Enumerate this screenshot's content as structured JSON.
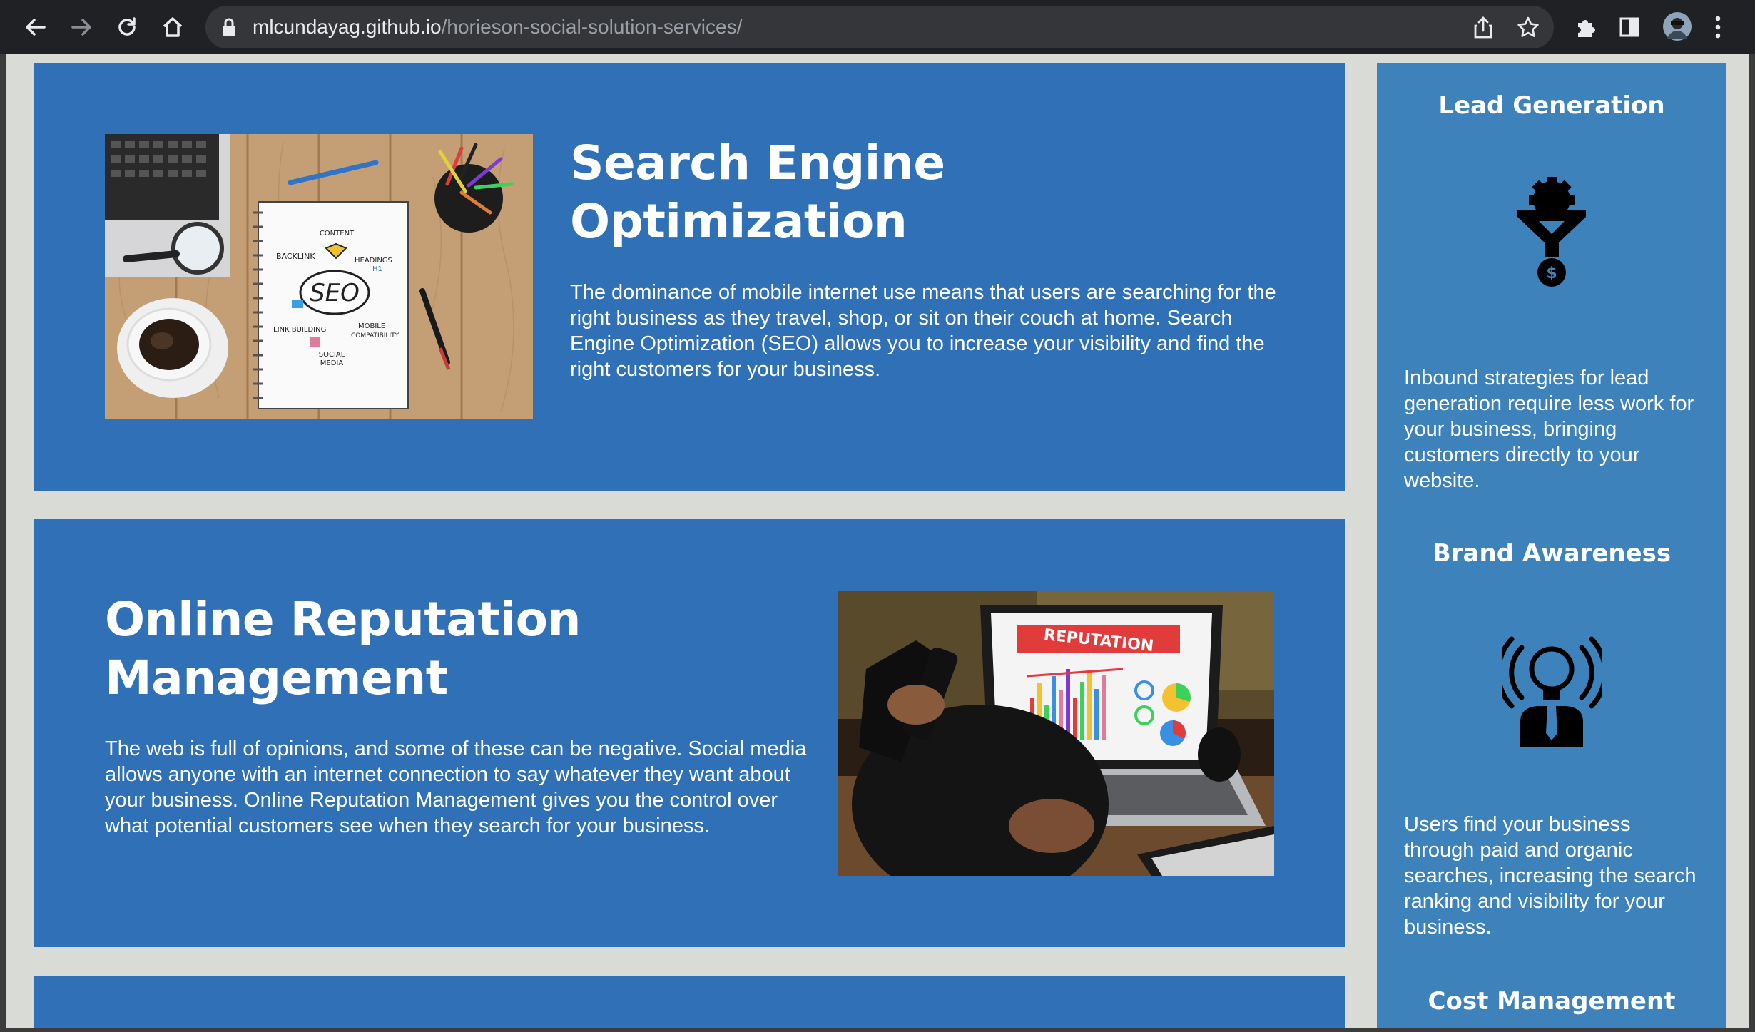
{
  "browser": {
    "url_host": "mlcundayag.github.io",
    "url_path": "/horieson-social-solution-services/",
    "icons": [
      "back-icon",
      "forward-icon",
      "reload-icon",
      "home-icon",
      "lock-icon",
      "share-icon",
      "star-icon",
      "extensions-icon",
      "sidepanel-icon",
      "avatar",
      "menu-icon"
    ]
  },
  "colors": {
    "card": "#2f70b6",
    "aside": "#3d82ba",
    "page_bg": "#d9dcd6"
  },
  "sections": [
    {
      "title": "Search Engine Optimization",
      "text": "The dominance of mobile internet use means that users are searching for the right business as they travel, shop, or sit on their couch at home. Search Engine Optimization (SEO) allows you to increase your visibility and find the right customers for your business.",
      "image": {
        "labels": [
          "CONTENT",
          "BACKLINK",
          "HEADINGS",
          "H1",
          "SEO",
          "LINK BUILDING",
          "MOBILE",
          "COMPATIBILITY",
          "SOCIAL",
          "MEDIA"
        ]
      }
    },
    {
      "title": "Online Reputation Management",
      "text": "The web is full of opinions, and some of these can be negative. Social media allows anyone with an internet connection to say whatever they want about your business. Online Reputation Management gives you the control over what potential customers see when they search for your business.",
      "image": {
        "banner": "REPUTATION"
      }
    }
  ],
  "benefits": [
    {
      "title": "Lead Generation",
      "icon": "lead-generation-icon",
      "text": "Inbound strategies for lead generation require less work for your business, bringing customers directly to your website."
    },
    {
      "title": "Brand Awareness",
      "icon": "brand-awareness-icon",
      "text": "Users find your business through paid and organic searches, increasing the search ranking and visibility for your business."
    },
    {
      "title": "Cost Management",
      "icon": "cost-management-icon",
      "text": ""
    }
  ]
}
